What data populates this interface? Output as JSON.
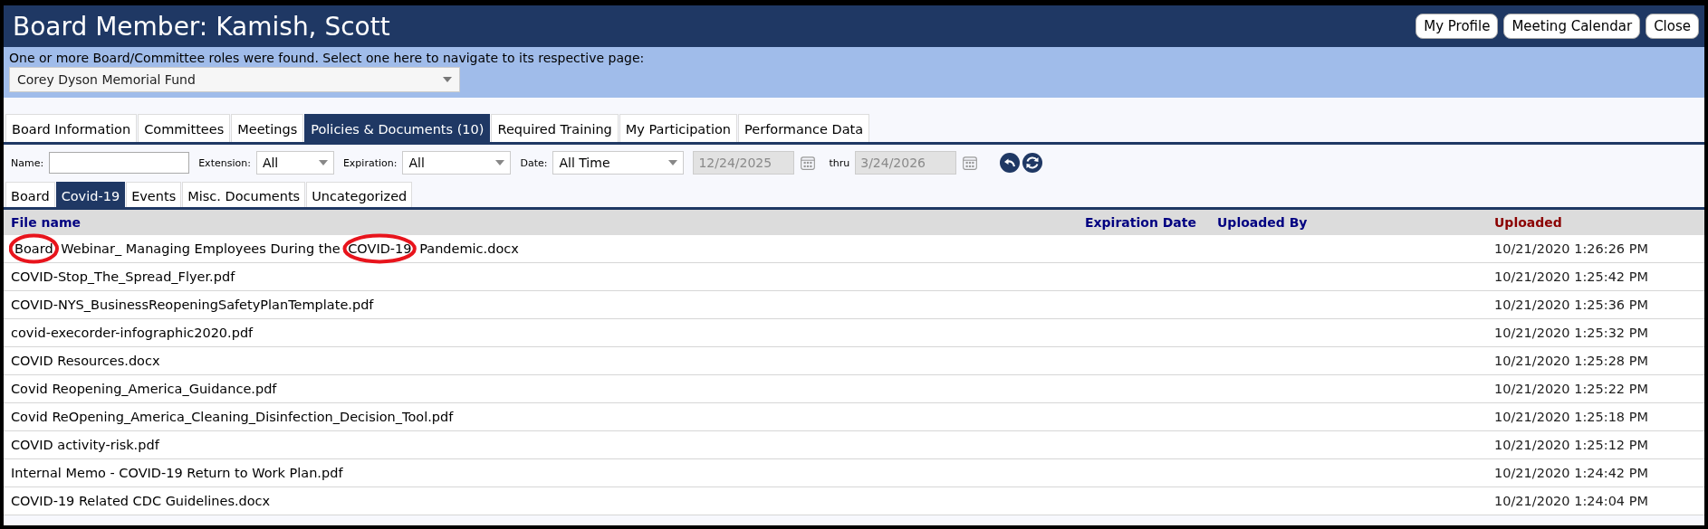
{
  "header": {
    "title": "Board Member: Kamish, Scott",
    "buttons": [
      "My Profile",
      "Meeting Calendar",
      "Close"
    ]
  },
  "role_banner": {
    "message": "One or more Board/Committee roles were found.  Select one here to navigate to its respective page:",
    "role_select": "Corey Dyson Memorial Fund"
  },
  "tabs": [
    {
      "label": "Board Information",
      "selected": false
    },
    {
      "label": "Committees",
      "selected": false
    },
    {
      "label": "Meetings",
      "selected": false
    },
    {
      "label": "Policies & Documents (10)",
      "selected": true
    },
    {
      "label": "Required Training",
      "selected": false
    },
    {
      "label": "My Participation",
      "selected": false
    },
    {
      "label": "Performance Data",
      "selected": false
    }
  ],
  "filters": {
    "name_label": "Name:",
    "extension_label": "Extension:",
    "extension": "All",
    "expiration_label": "Expiration:",
    "expiration": "All",
    "date_label": "Date:",
    "date": "All Time",
    "from": "12/24/2025",
    "thru_label": "thru",
    "thru": "3/24/2026",
    "dates_disabled": true
  },
  "category_tabs": [
    {
      "label": "Board",
      "selected": false
    },
    {
      "label": "Covid-19",
      "selected": true
    },
    {
      "label": "Events",
      "selected": false
    },
    {
      "label": "Misc. Documents",
      "selected": false
    },
    {
      "label": "Uncategorized",
      "selected": false
    }
  ],
  "table": {
    "columns": [
      {
        "label": "File name",
        "sorted": false
      },
      {
        "label": "Expiration Date",
        "sorted": false
      },
      {
        "label": "Uploaded By",
        "sorted": false
      },
      {
        "label": "Uploaded",
        "sorted": true
      }
    ],
    "rows": [
      {
        "file_name": [
          {
            "text": "Board",
            "circled": true
          },
          {
            "text": " Webinar_ Managing Employees During the ",
            "circled": false
          },
          {
            "text": "COVID-19",
            "circled": true
          },
          {
            "text": " Pandemic.docx",
            "circled": false
          }
        ],
        "uploaded": "10/21/2020 1:26:26 PM"
      },
      {
        "file_name": [
          {
            "text": "COVID-Stop_The_Spread_Flyer.pdf",
            "circled": false
          }
        ],
        "uploaded": "10/21/2020 1:25:42 PM"
      },
      {
        "file_name": [
          {
            "text": "COVID-NYS_BusinessReopeningSafetyPlanTemplate.pdf",
            "circled": false
          }
        ],
        "uploaded": "10/21/2020 1:25:36 PM"
      },
      {
        "file_name": [
          {
            "text": "covid-execorder-infographic2020.pdf",
            "circled": false
          }
        ],
        "uploaded": "10/21/2020 1:25:32 PM"
      },
      {
        "file_name": [
          {
            "text": "COVID Resources.docx",
            "circled": false
          }
        ],
        "uploaded": "10/21/2020 1:25:28 PM"
      },
      {
        "file_name": [
          {
            "text": "Covid Reopening_America_Guidance.pdf",
            "circled": false
          }
        ],
        "uploaded": "10/21/2020 1:25:22 PM"
      },
      {
        "file_name": [
          {
            "text": "Covid ReOpening_America_Cleaning_Disinfection_Decision_Tool.pdf",
            "circled": false
          }
        ],
        "uploaded": "10/21/2020 1:25:18 PM"
      },
      {
        "file_name": [
          {
            "text": "COVID activity-risk.pdf",
            "circled": false
          }
        ],
        "uploaded": "10/21/2020 1:25:12 PM"
      },
      {
        "file_name": [
          {
            "text": "Internal Memo - COVID-19 Return to Work Plan.pdf",
            "circled": false
          }
        ],
        "uploaded": "10/21/2020 1:24:42 PM"
      },
      {
        "file_name": [
          {
            "text": "COVID-19 Related CDC Guidelines.docx",
            "circled": false
          }
        ],
        "uploaded": "10/21/2020 1:24:04 PM"
      }
    ]
  }
}
